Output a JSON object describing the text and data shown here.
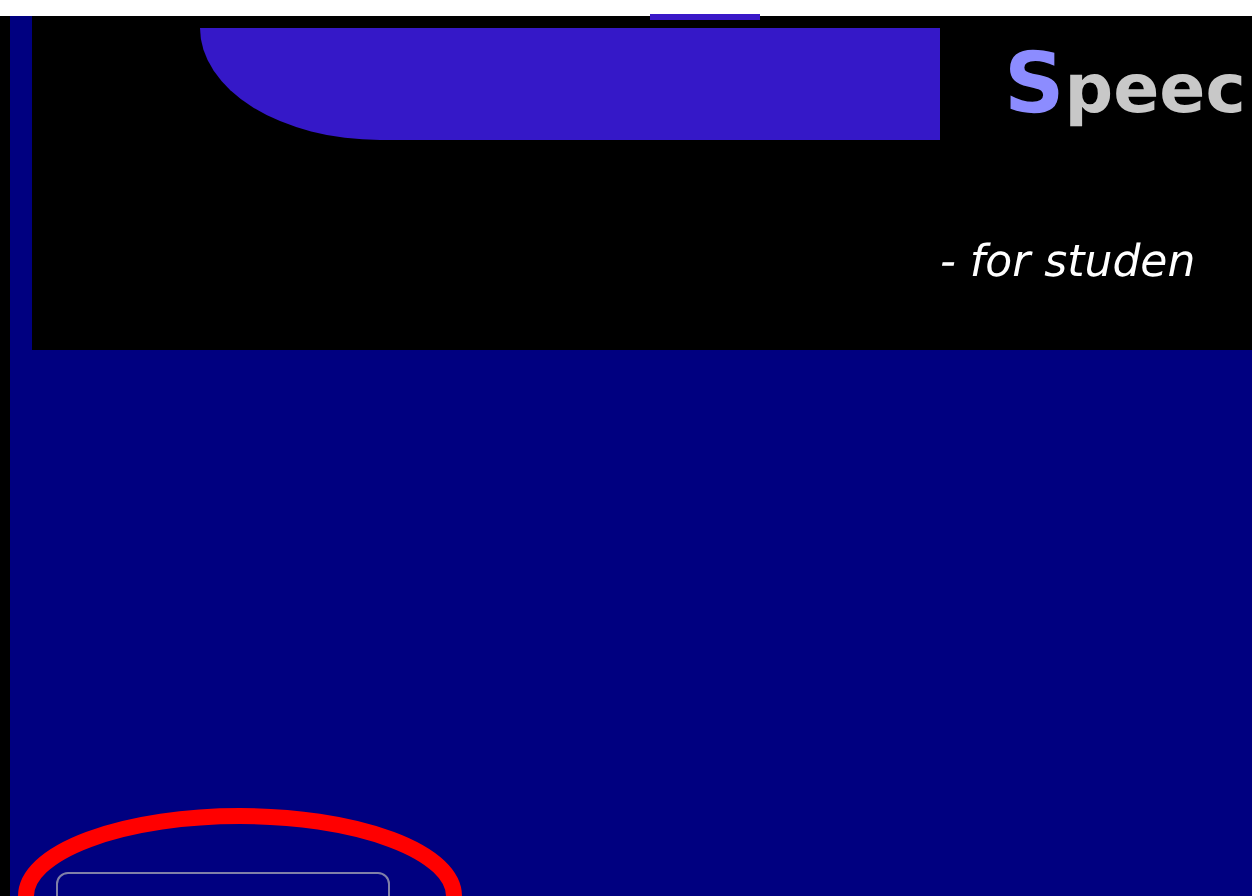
{
  "header": {
    "title_initial": "S",
    "title_rest": "peec",
    "subtitle": "- for studen"
  },
  "annotation": {
    "kind": "ellipse",
    "color": "#ff0000"
  }
}
